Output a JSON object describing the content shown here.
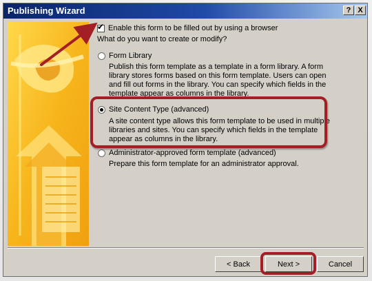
{
  "window": {
    "title": "Publishing Wizard"
  },
  "titlebar_buttons": {
    "help": "?",
    "close": "X"
  },
  "browser_option": {
    "label": "Enable this form to be filled out by using a browser",
    "checked": true
  },
  "question": "What do you want to create or modify?",
  "options": [
    {
      "label": "Form Library",
      "selected": false,
      "description": [
        "Publish this form template as a template in a form library. A form",
        "library stores forms based on this form template. Users can open",
        "and fill out forms in the library. You can specify which fields in the",
        "template appear as columns in the library."
      ]
    },
    {
      "label": "Site Content Type (advanced)",
      "selected": true,
      "description": [
        "A site content type allows this form template to be used in multiple",
        "libraries and sites. You can specify which fields in the template",
        "appear as columns in the library."
      ]
    },
    {
      "label": "Administrator-approved form template (advanced)",
      "selected": false,
      "description": [
        "Prepare this form template for an administrator approval."
      ]
    }
  ],
  "buttons": {
    "back": "< Back",
    "next": "Next >",
    "cancel": "Cancel"
  },
  "annotation_color": "#a41e26"
}
